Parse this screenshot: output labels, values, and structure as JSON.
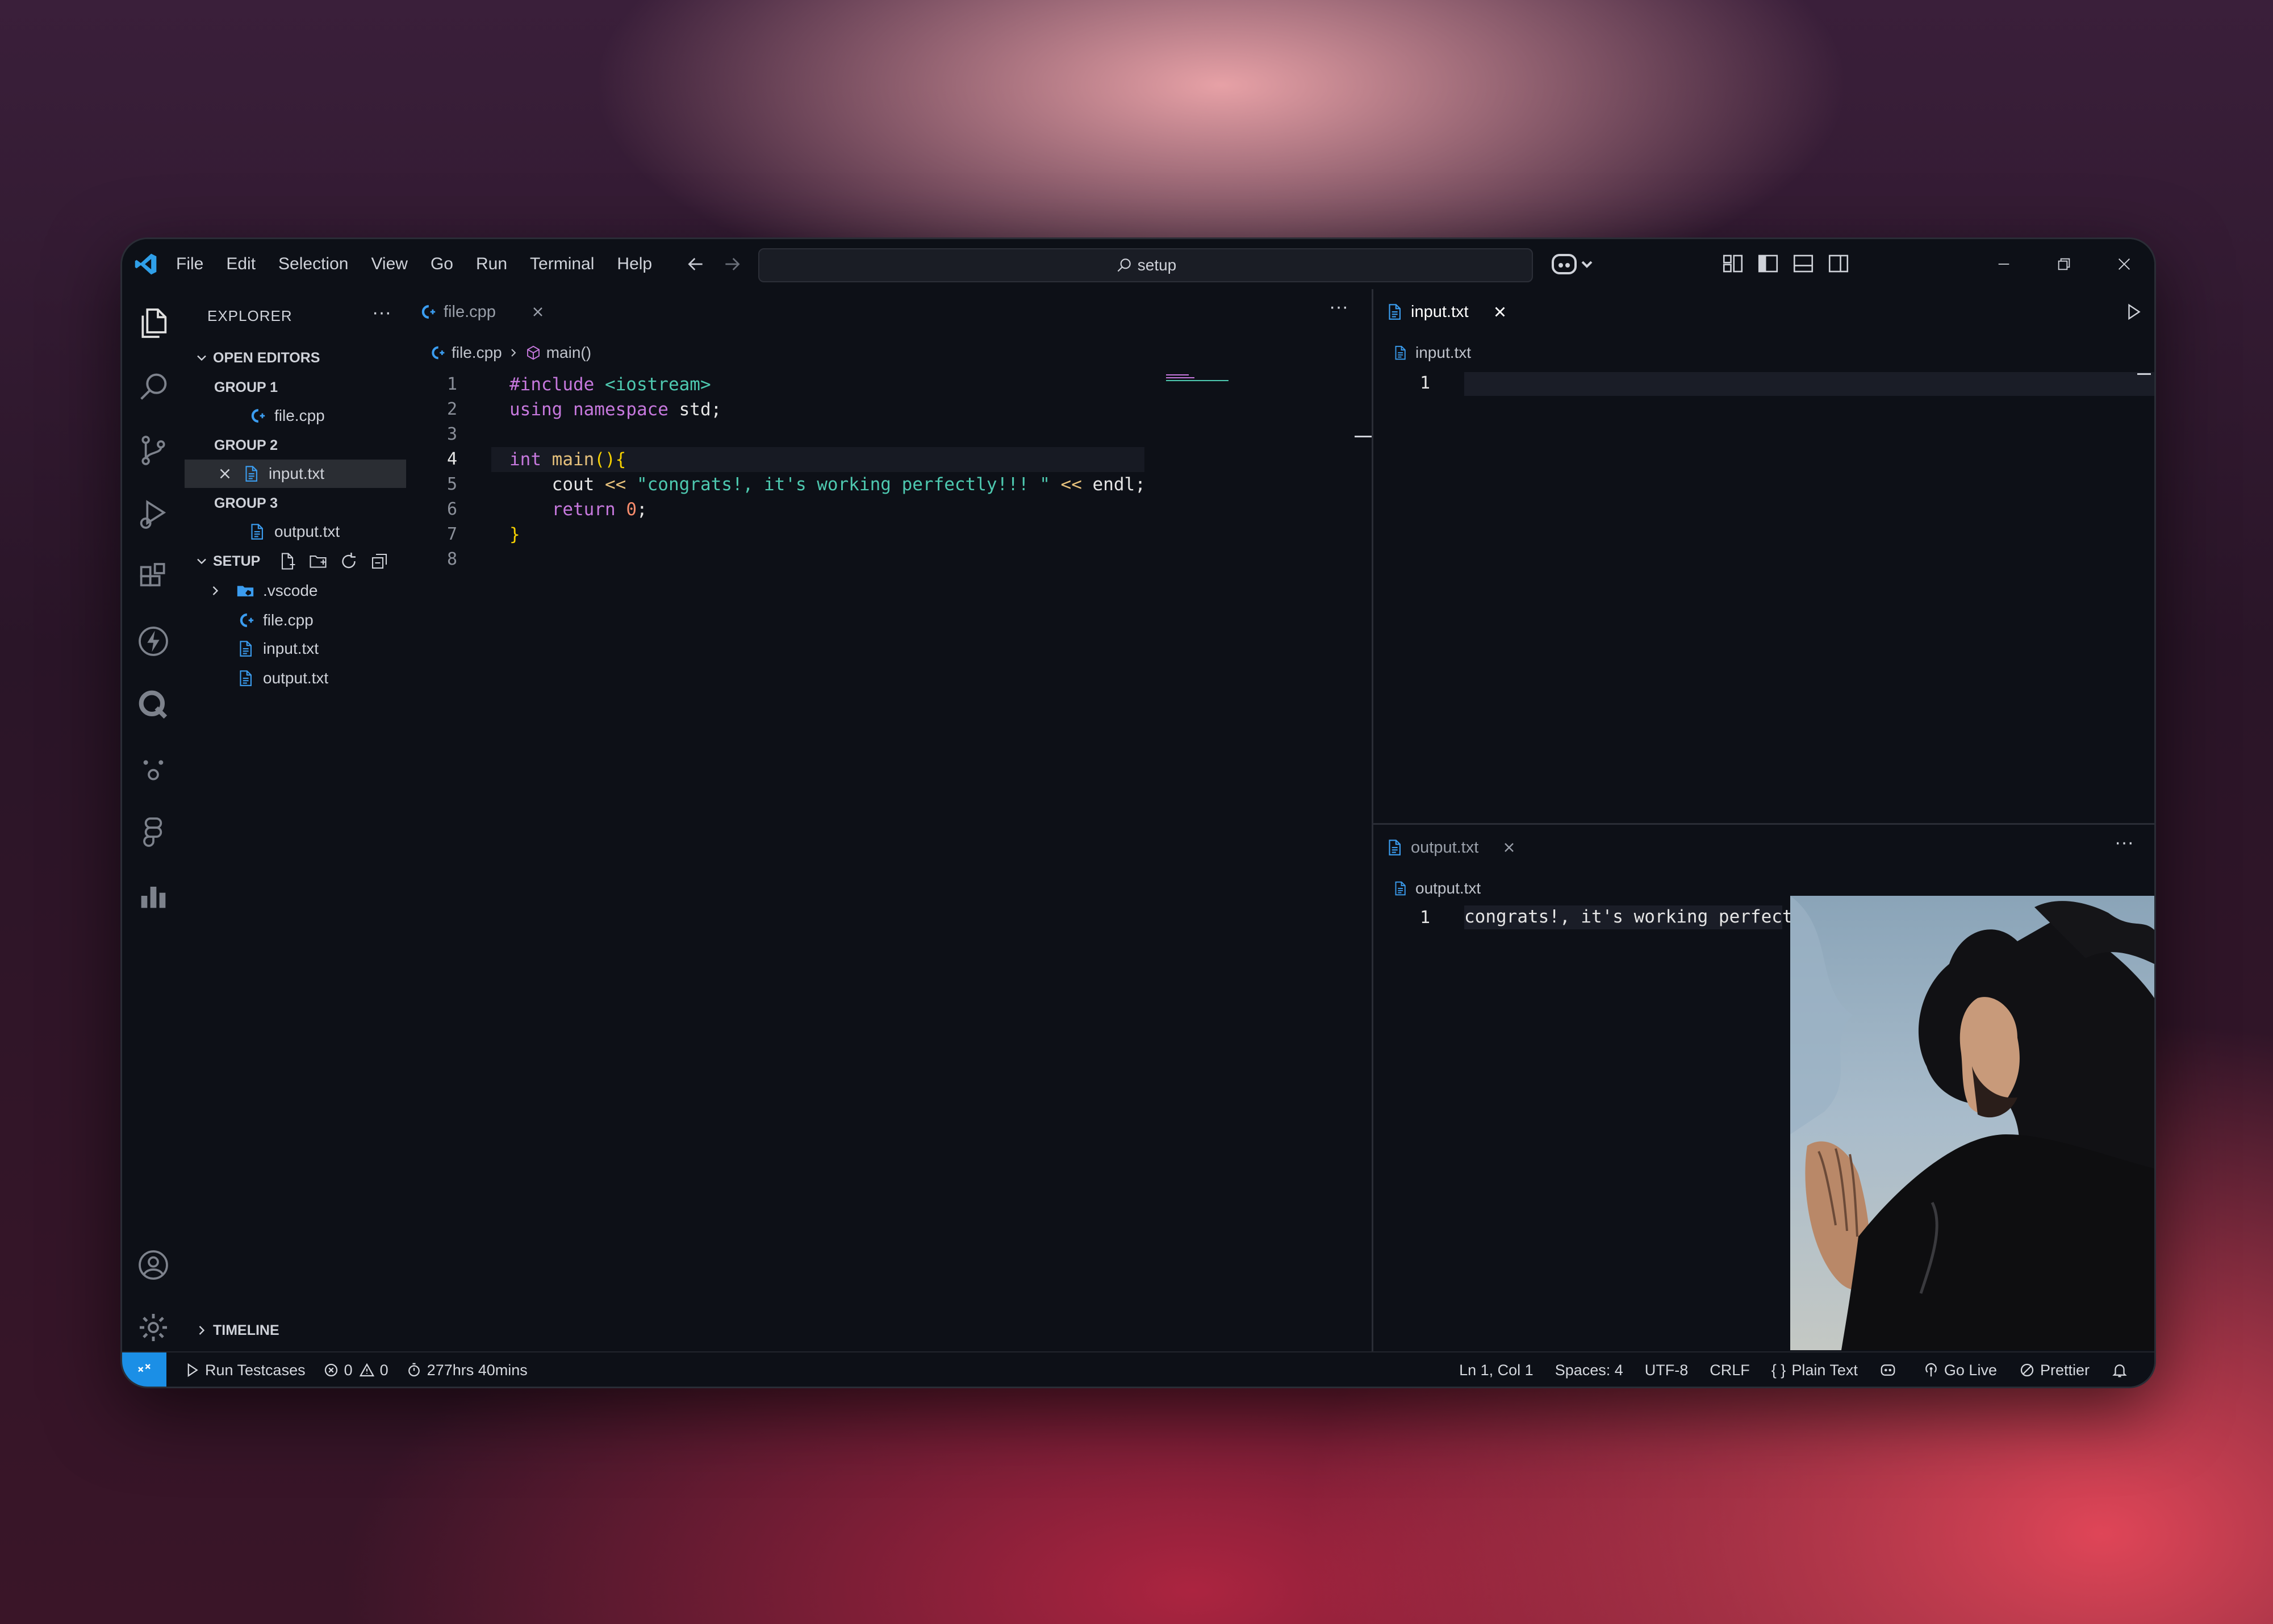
{
  "window": {
    "menu": [
      "File",
      "Edit",
      "Selection",
      "View",
      "Go",
      "Run",
      "Terminal",
      "Help"
    ],
    "search_text": "setup",
    "accent": "#1b8fe6"
  },
  "icons": {
    "activity": [
      "explorer-icon",
      "search-icon",
      "source-control-icon",
      "run-debug-icon",
      "extensions-icon",
      "bolt-icon",
      "q-icon",
      "face-icon",
      "figma-icon",
      "chart-icon",
      "account-icon",
      "gear-icon"
    ]
  },
  "sidebar": {
    "title": "EXPLORER",
    "open_editors": "OPEN EDITORS",
    "groups": [
      {
        "label": "GROUP 1",
        "file": "file.cpp"
      },
      {
        "label": "GROUP 2",
        "file": "input.txt"
      },
      {
        "label": "GROUP 3",
        "file": "output.txt"
      }
    ],
    "folder": "SETUP",
    "tree": [
      ".vscode",
      "file.cpp",
      "input.txt",
      "output.txt"
    ],
    "timeline": "TIMELINE"
  },
  "editor_left": {
    "tab": "file.cpp",
    "breadcrumb_file": "file.cpp",
    "breadcrumb_symbol": "main()",
    "line_numbers": [
      "1",
      "2",
      "3",
      "4",
      "5",
      "6",
      "7",
      "8"
    ]
  },
  "editor_right_top": {
    "tab": "input.txt",
    "breadcrumb_file": "input.txt",
    "line_number": "1"
  },
  "editor_right_bottom": {
    "tab": "output.txt",
    "breadcrumb_file": "output.txt",
    "line_number": "1",
    "content": "congrats!, it's working perfectly!!!"
  },
  "status": {
    "run_testcases": "Run Testcases",
    "errors": "0",
    "warnings": "0",
    "time": "277hrs 40mins",
    "position": "Ln 1, Col 1",
    "spaces": "Spaces: 4",
    "encoding": "UTF-8",
    "eol": "CRLF",
    "language": "Plain Text",
    "go_live": "Go Live",
    "prettier": "Prettier"
  }
}
